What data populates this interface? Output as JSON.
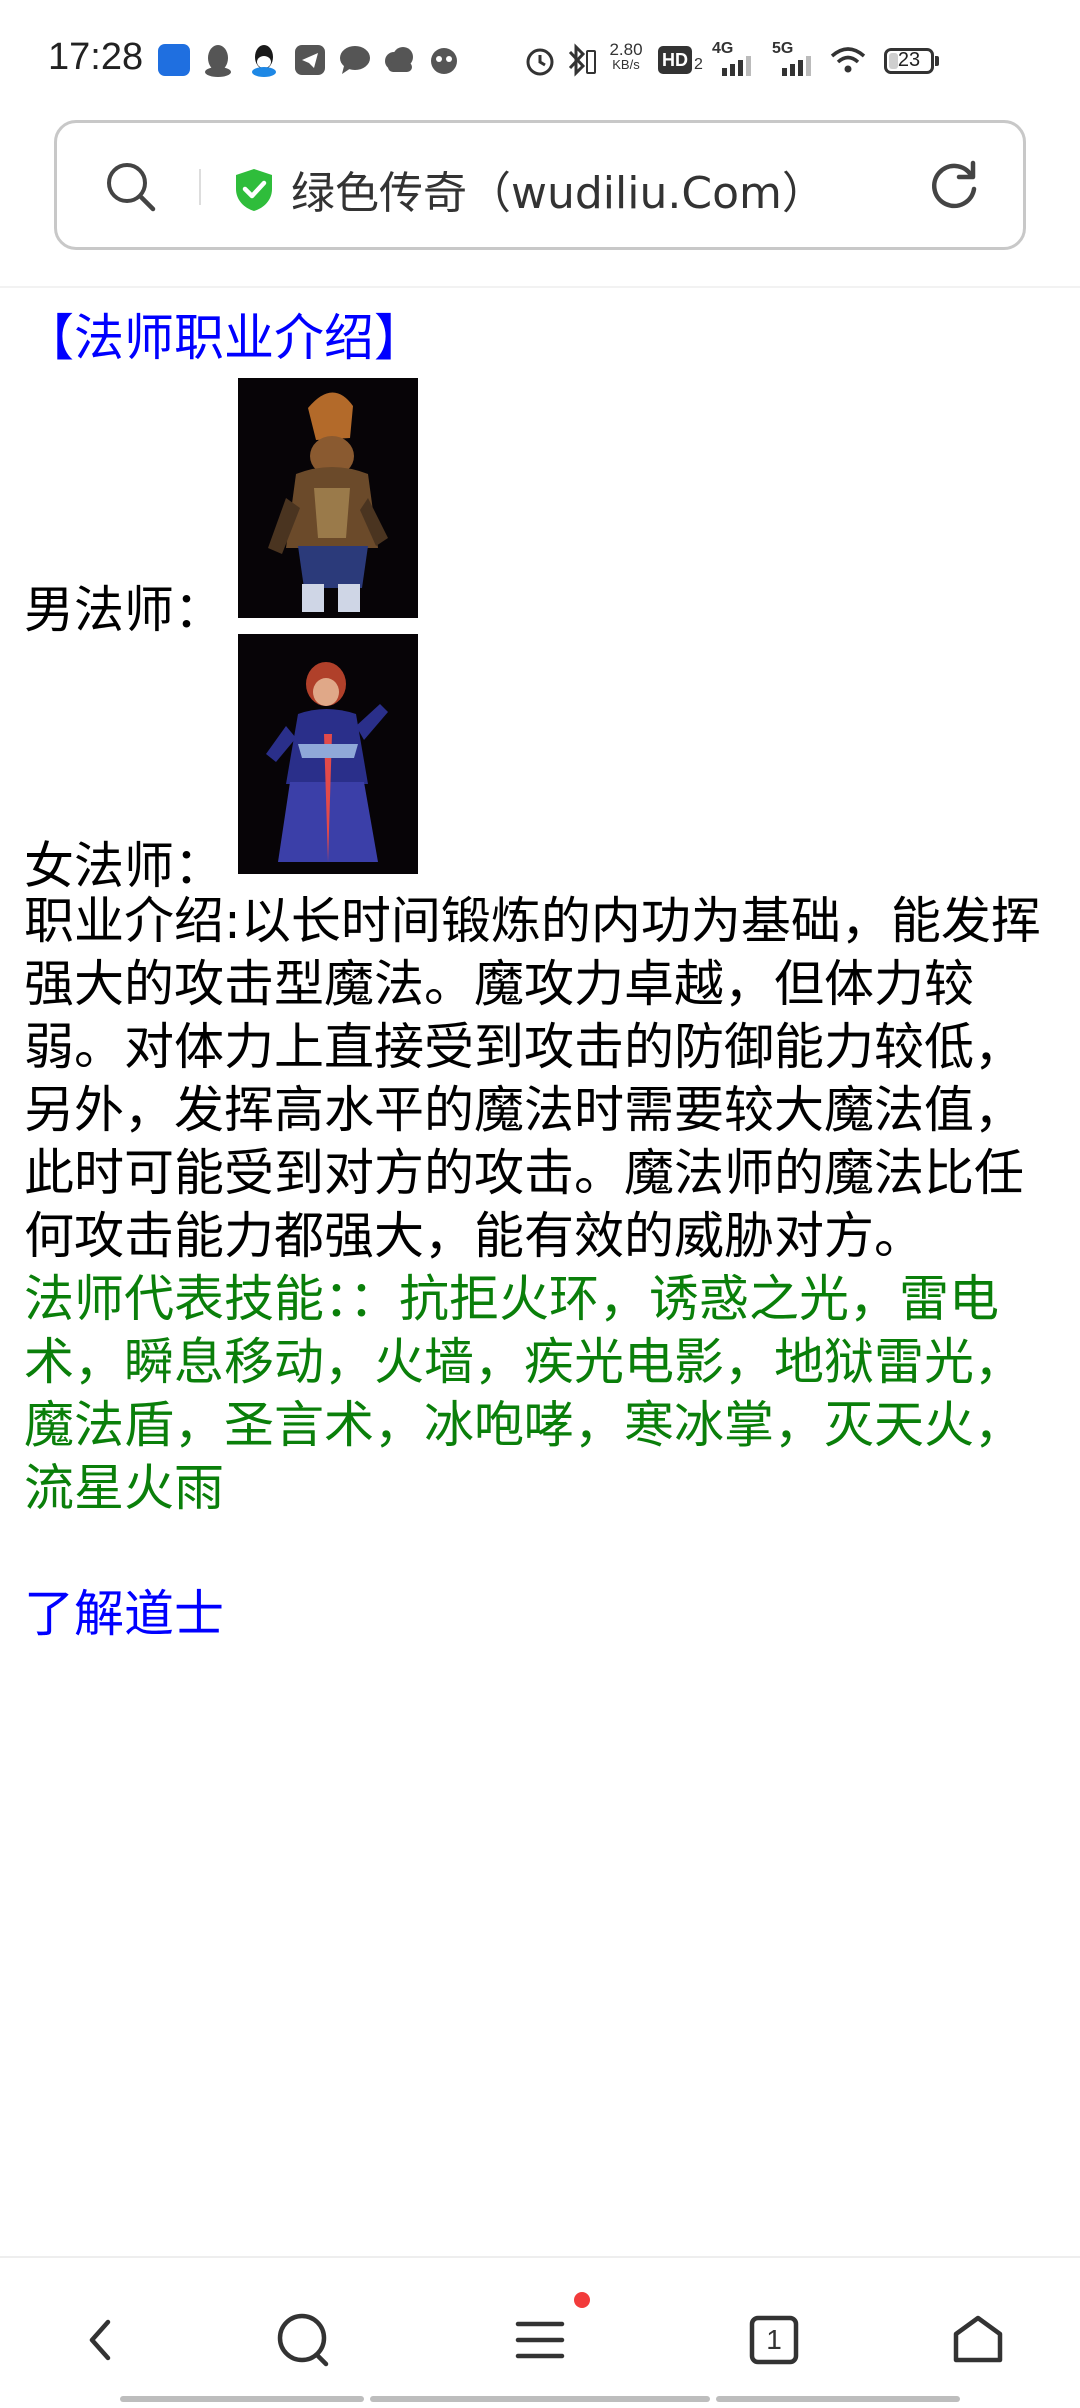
{
  "status_bar": {
    "time": "17:28",
    "network_speed_value": "2.80",
    "network_speed_unit": "KB/s",
    "hd_label": "HD",
    "hd_sub": "2",
    "signal_4g": "4G",
    "signal_5g": "5G",
    "battery": "23",
    "battery_level": 0.23
  },
  "address_bar": {
    "title": "绿色传奇（wudiliu.Com）"
  },
  "page": {
    "heading": "【法师职业介绍】",
    "male_label": "男法师：",
    "female_label": "女法师：",
    "description": "职业介绍:以长时间锻炼的内功为基础，能发挥强大的攻击型魔法。魔攻力卓越，但体力较弱。对体力上直接受到攻击的防御能力较低，另外，发挥高水平的魔法时需要较大魔法值，此时可能受到对方的攻击。魔法师的魔法比任何攻击能力都强大，能有效的威胁对方。",
    "skills": "法师代表技能：：抗拒火环，诱惑之光，雷电术，瞬息移动，火墙，疾光电影，地狱雷光，魔法盾，圣言术，冰咆哮，寒冰掌，灭天火，流星火雨",
    "learn_link": "了解道士"
  },
  "bottom_nav": {
    "tab_count": "1"
  },
  "colors": {
    "heading_link": "#0000ff",
    "skills_text": "#0a7f0a",
    "shield": "#2fbd3b",
    "badge_dot": "#f23b3b"
  },
  "icons": {
    "address_bar": [
      "search-icon",
      "security-shield-icon",
      "refresh-icon"
    ],
    "bottom_nav": [
      "back-icon",
      "search-icon",
      "menu-icon",
      "tabs-icon",
      "home-icon"
    ]
  }
}
